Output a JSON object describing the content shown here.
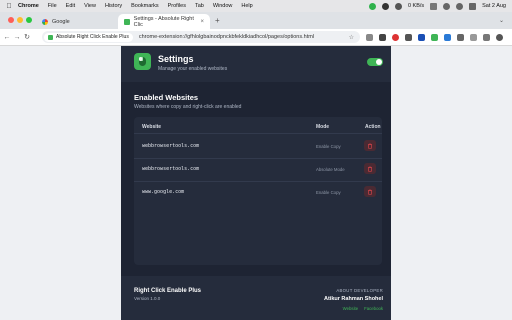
{
  "menubar": {
    "app": "Chrome",
    "items": [
      "File",
      "Edit",
      "View",
      "History",
      "Bookmarks",
      "Profiles",
      "Tab",
      "Window",
      "Help"
    ],
    "speed": "0 KB/s",
    "clock": "Sat 2 Aug"
  },
  "tabs": [
    {
      "label": "Google"
    },
    {
      "label": "Settings - Absolute Right Clic"
    }
  ],
  "toolbar": {
    "chip": "Absolute Right Click Enable Plus",
    "url": "chrome-extension://gfhlolgbainodpnckbfekldkiadhcol/pages/options.html"
  },
  "settings": {
    "title": "Settings",
    "subtitle": "Manage your enabled websites",
    "enabled": true,
    "accent": "#3fb556",
    "background": "#1e2433"
  },
  "enabled_websites": {
    "title": "Enabled Websites",
    "subtitle": "Websites where copy and right-click are enabled",
    "columns": {
      "website": "Website",
      "mode": "Mode",
      "action": "Action"
    },
    "rows": [
      {
        "website": "webbrowsertools.com",
        "mode": "Enable Copy"
      },
      {
        "website": "webbrowsertools.com",
        "mode": "Absolute Mode"
      },
      {
        "website": "www.google.com",
        "mode": "Enable Copy"
      }
    ]
  },
  "footer": {
    "name": "Right Click Enable Plus",
    "version": "Version 1.0.0",
    "about_label": "ABOUT DEVELOPER",
    "author": "Atikur Rahman Shohel",
    "links": [
      "Website",
      "Facebook"
    ]
  }
}
